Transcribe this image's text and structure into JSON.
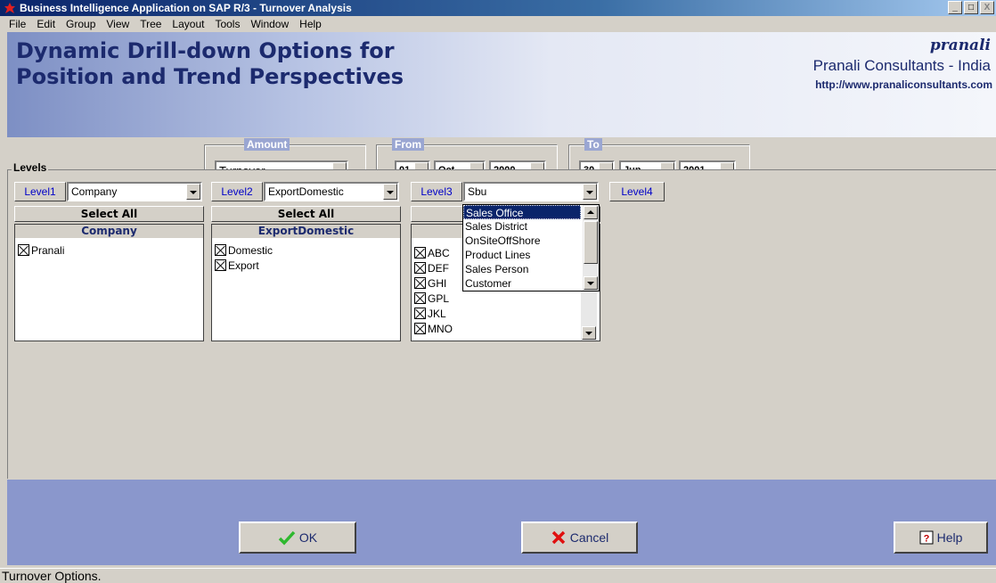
{
  "window": {
    "title": "Business Intelligence Application on SAP R/3 - Turnover Analysis",
    "controls": [
      "_",
      "□",
      "X"
    ]
  },
  "menu": [
    "File",
    "Edit",
    "Group",
    "View",
    "Tree",
    "Layout",
    "Tools",
    "Window",
    "Help"
  ],
  "header": {
    "title_line1": "Dynamic Drill-down Options for",
    "title_line2": "Position and Trend Perspectives",
    "logo": "pranali",
    "company": "Pranali Consultants - India",
    "url": "http://www.pranaliconsultants.com"
  },
  "amount": {
    "label": "Amount",
    "value": "Turnover"
  },
  "from": {
    "label": "From",
    "day": "01",
    "month": "Oct",
    "year": "2000"
  },
  "to": {
    "label": "To",
    "day": "30",
    "month": "Jun",
    "year": "2001"
  },
  "levels": {
    "label": "Levels",
    "level1": {
      "button": "Level1",
      "value": "Company",
      "select_all": "Select All",
      "header": "Company",
      "items": [
        "Pranali"
      ]
    },
    "level2": {
      "button": "Level2",
      "value": "ExportDomestic",
      "select_all": "Select All",
      "header": "ExportDomestic",
      "items": [
        "Domestic",
        "Export"
      ]
    },
    "level3": {
      "button": "Level3",
      "value": "Sbu",
      "items": [
        "ABC",
        "DEF",
        "GHI",
        "GPL",
        "JKL",
        "MNO"
      ],
      "dropdown": [
        "Sales Office",
        "Sales District",
        "OnSiteOffShore",
        "Product Lines",
        "Sales Person",
        "Customer"
      ],
      "dropdown_selected": 0
    },
    "level4": {
      "button": "Level4"
    }
  },
  "buttons": {
    "ok": "OK",
    "cancel": "Cancel",
    "help": "Help"
  },
  "status": "Turnover Options.",
  "colors": {
    "title_bar": "#0a246a",
    "accent_blue": "#1c2a6e",
    "bottom_bar": "#8a97cc",
    "ok_check": "#2eb82e",
    "cancel_x": "#e01010"
  }
}
